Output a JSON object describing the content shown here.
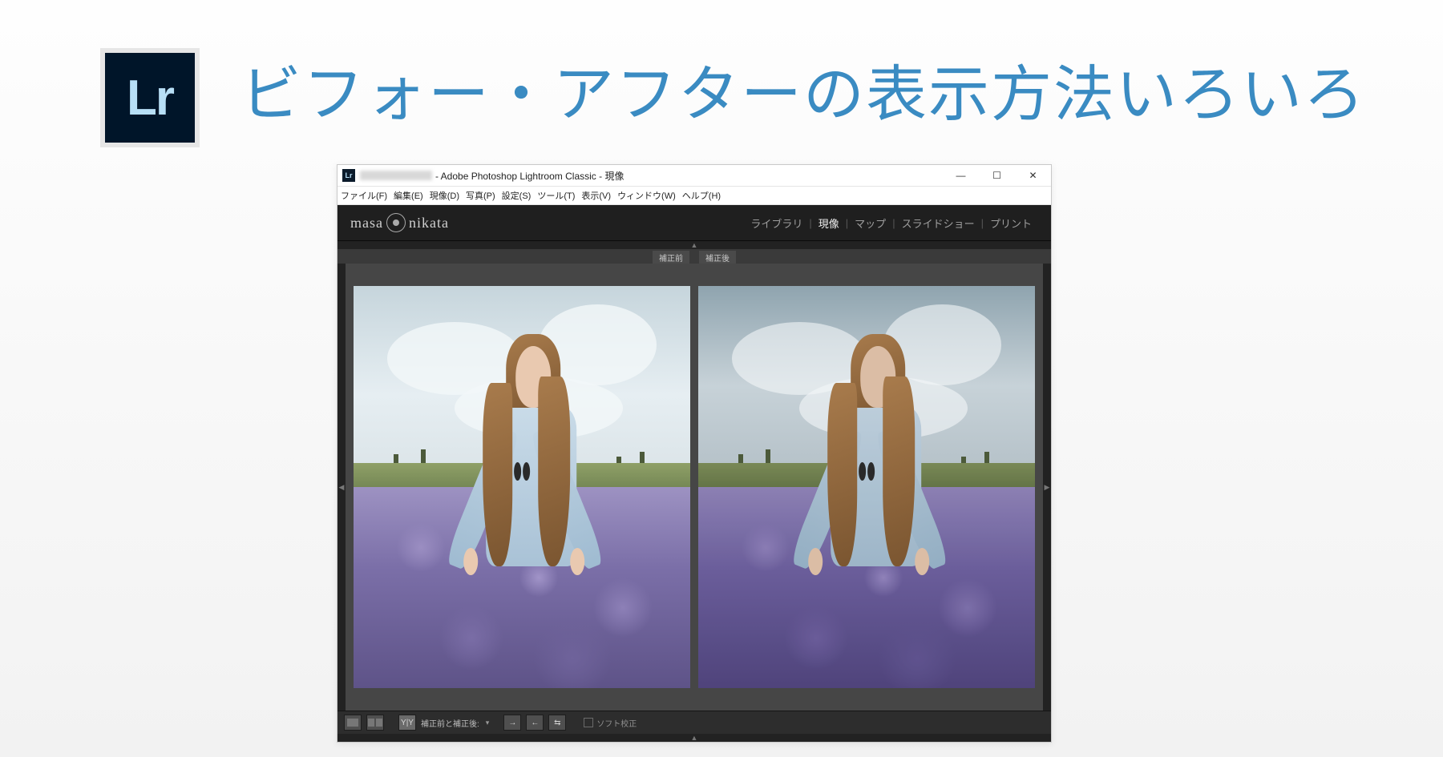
{
  "page": {
    "title": "ビフォー・アフターの表示方法いろいろ",
    "badge_text": "Lr"
  },
  "window": {
    "icon_text": "Lr",
    "title": " - Adobe Photoshop Lightroom Classic - 現像",
    "controls": {
      "minimize": "—",
      "maximize": "☐",
      "close": "✕"
    }
  },
  "menubar": [
    "ファイル(F)",
    "編集(E)",
    "現像(D)",
    "写真(P)",
    "設定(S)",
    "ツール(T)",
    "表示(V)",
    "ウィンドウ(W)",
    "ヘルプ(H)"
  ],
  "brand": {
    "left": "masa",
    "right": "nikata"
  },
  "modules": {
    "items": [
      "ライブラリ",
      "現像",
      "マップ",
      "スライドショー",
      "プリント"
    ],
    "active_index": 1,
    "separator": " | "
  },
  "compare": {
    "before_label": "補正前",
    "after_label": "補正後"
  },
  "toolbar": {
    "mode_label": "補正前と補正後:",
    "yy_button": "Y|Y",
    "soft_proof": "ソフト校正"
  }
}
